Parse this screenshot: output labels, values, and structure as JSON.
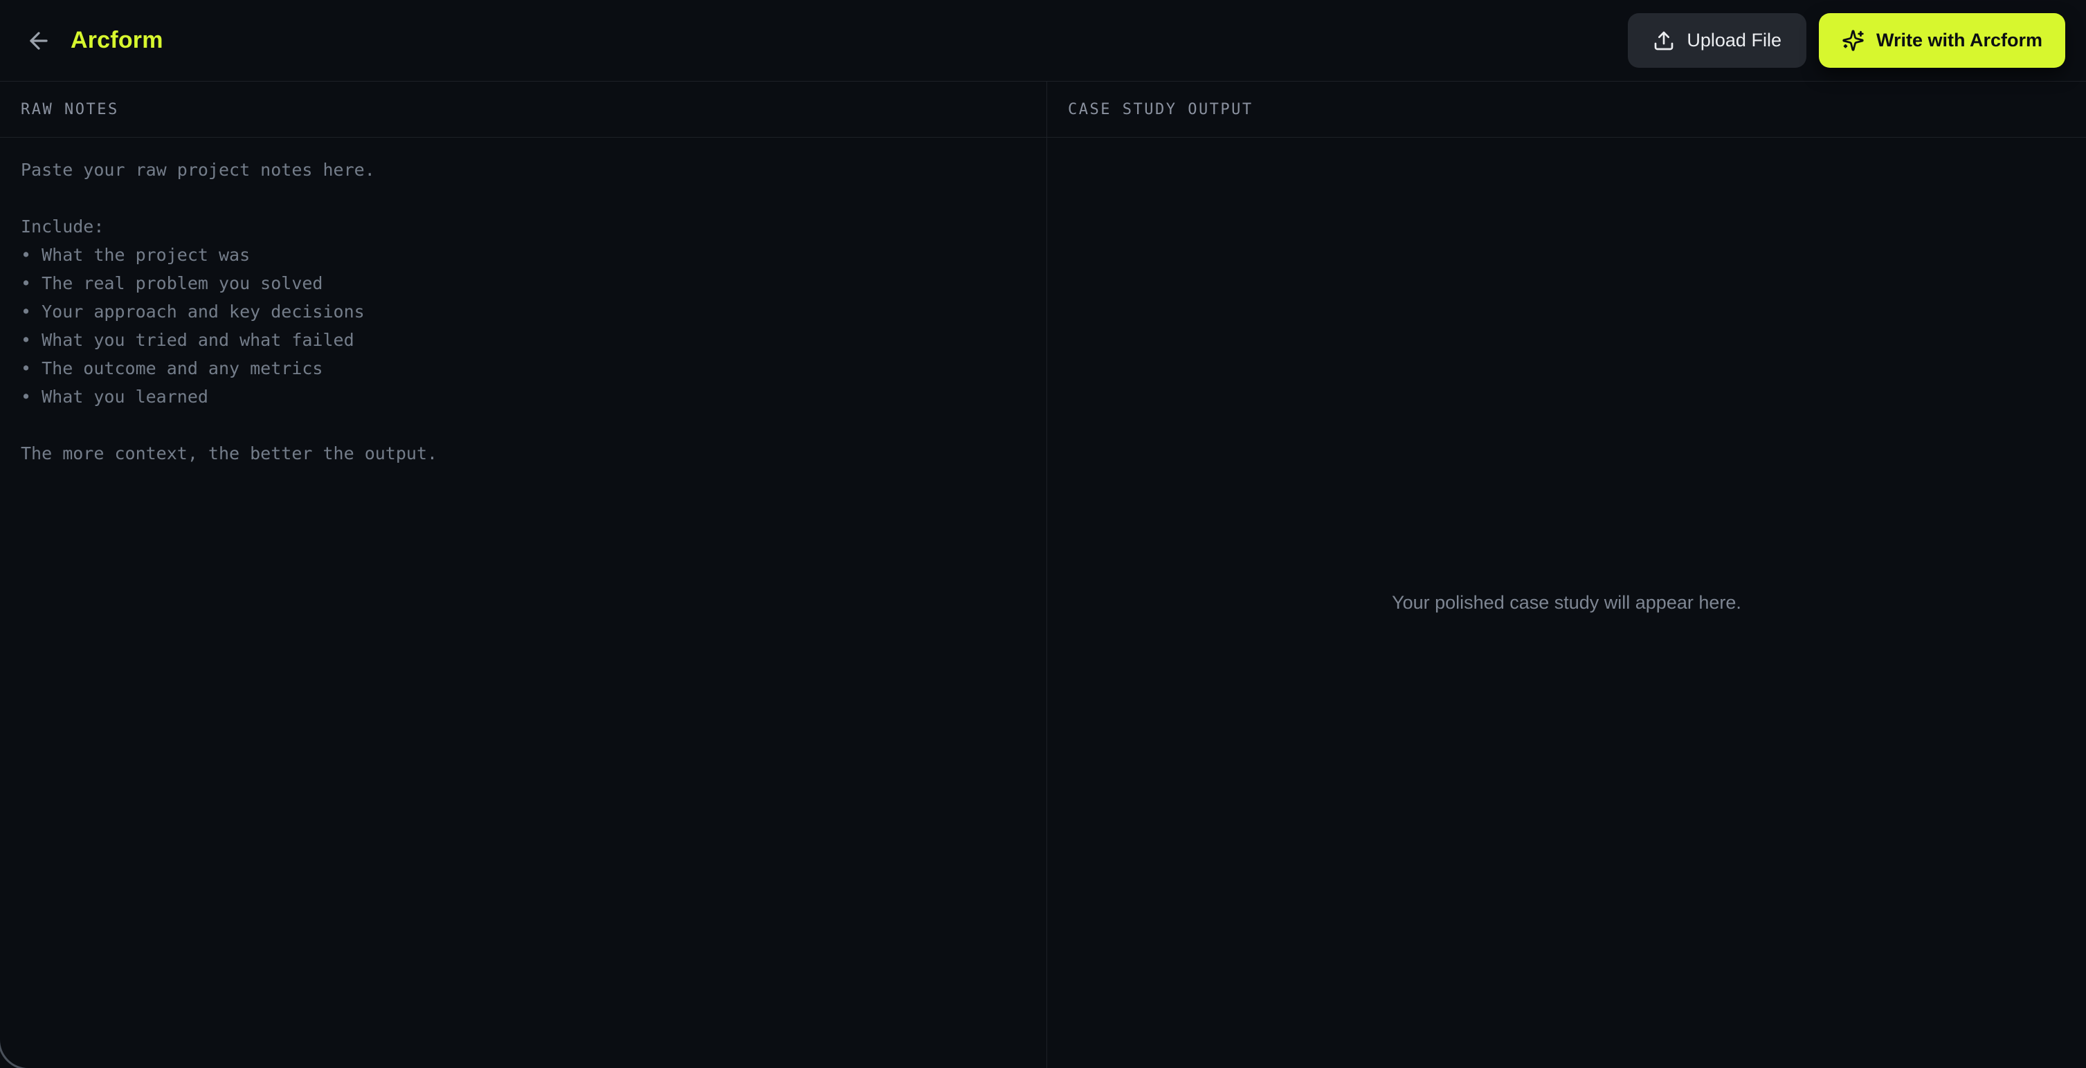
{
  "app": {
    "title": "Arcform"
  },
  "header": {
    "back_icon": "arrow-left-icon",
    "upload_button": {
      "label": "Upload File",
      "icon": "upload-icon"
    },
    "write_button": {
      "label": "Write with Arcform",
      "icon": "sparkles-icon"
    }
  },
  "panels": {
    "raw_notes": {
      "header": "RAW NOTES",
      "value": "",
      "placeholder": "Paste your raw project notes here.\n\nInclude:\n• What the project was\n• The real problem you solved\n• Your approach and key decisions\n• What you tried and what failed\n• The outcome and any metrics\n• What you learned\n\nThe more context, the better the output."
    },
    "output": {
      "header": "CASE STUDY OUTPUT",
      "empty_state": "Your polished case study will appear here."
    }
  },
  "colors": {
    "accent": "#d7f72e",
    "background": "#0a0d12",
    "border": "#1d2127",
    "muted_text": "#747d8a",
    "upload_button_bg": "#24282f"
  }
}
